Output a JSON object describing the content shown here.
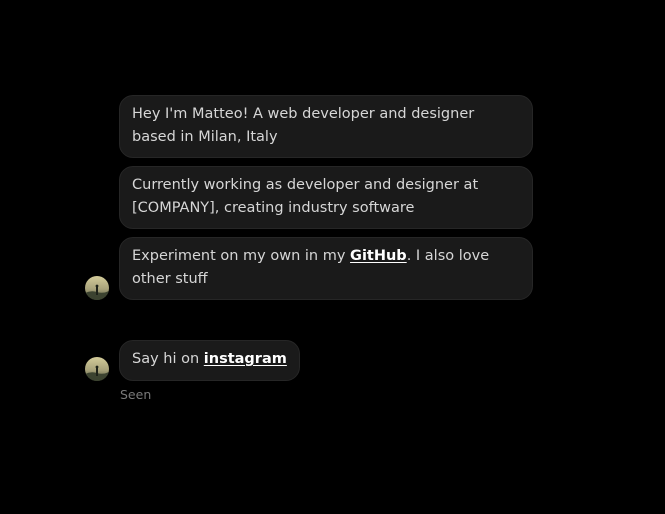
{
  "messages": [
    {
      "text": "Hey I'm Matteo! A web developer and designer based in Milan, Italy"
    },
    {
      "text": "Currently working as developer and designer at [COMPANY], creating industry software"
    },
    {
      "before": "Experiment on my own in my ",
      "link": "GitHub",
      "after": ". I also love other stuff"
    },
    {
      "before": "Say hi on ",
      "link": "instagram"
    }
  ],
  "status": {
    "seen": "Seen"
  },
  "colors": {
    "background": "#000000",
    "bubble": "#1a1a1a",
    "text": "#d6d6d6",
    "link": "#ffffff",
    "muted": "#7a7a7a"
  }
}
